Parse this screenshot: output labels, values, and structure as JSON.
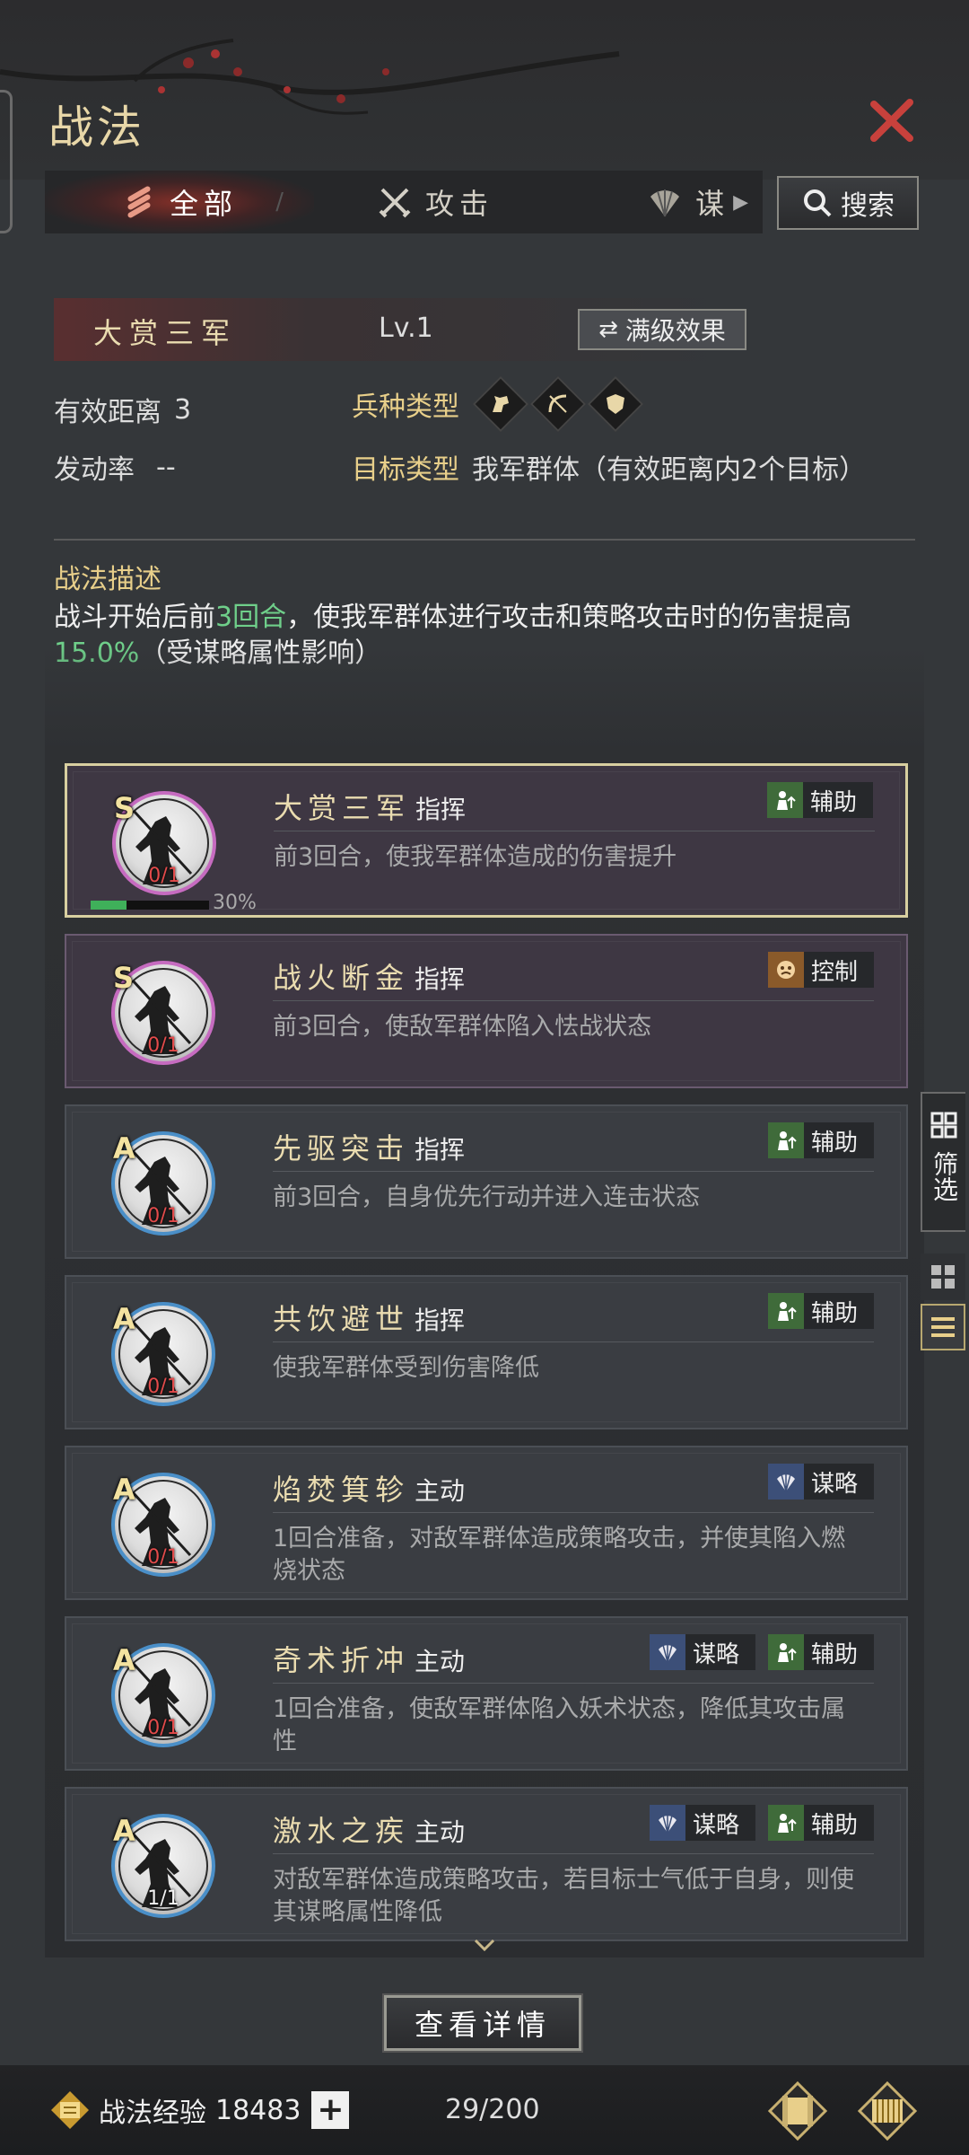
{
  "header": {
    "title": "战法",
    "close_icon": "close-icon",
    "accent": "#c8413c"
  },
  "tabs": [
    {
      "label": "全部",
      "icon": "scroll-bundle-icon",
      "active": true
    },
    {
      "label": "攻击",
      "icon": "crossed-swords-icon",
      "active": false
    },
    {
      "label": "谋",
      "icon": "fan-icon",
      "active": false
    }
  ],
  "search": {
    "label": "搜索",
    "icon": "search-icon"
  },
  "skill": {
    "name": "大赏三军",
    "level": "Lv.1",
    "max_effect_label": "满级效果",
    "range_label": "有效距离",
    "range_value": "3",
    "unit_type_label": "兵种类型",
    "unit_icons": [
      "cavalry-icon",
      "archer-icon",
      "shield-icon"
    ],
    "trigger_label": "发动率",
    "trigger_value": "--",
    "target_label": "目标类型",
    "target_value": "我军群体（有效距离内2个目标）",
    "desc_title": "战法描述",
    "desc_part1": "战斗开始后前",
    "desc_hl1": "3回合",
    "desc_part2": "，使我军群体进行攻击和策略攻击时的伤害提高",
    "desc_hl2": "15.0%",
    "desc_part3": "（受谋略属性影响）"
  },
  "cards": [
    {
      "grade": "S",
      "name": "大赏三军",
      "type": "指挥",
      "desc": "前3回合，使我军群体造成的伤害提升",
      "count": "0/1",
      "tags": [
        {
          "label": "辅助",
          "icon": "support-icon",
          "color": "green"
        }
      ],
      "progress": 0.3,
      "progress_label": "30%"
    },
    {
      "grade": "S",
      "name": "战火断金",
      "type": "指挥",
      "desc": "前3回合，使敌军群体陷入怯战状态",
      "count": "0/1",
      "tags": [
        {
          "label": "控制",
          "icon": "control-icon",
          "color": "orange"
        }
      ]
    },
    {
      "grade": "A",
      "name": "先驱突击",
      "type": "指挥",
      "desc": "前3回合，自身优先行动并进入连击状态",
      "count": "0/1",
      "tags": [
        {
          "label": "辅助",
          "icon": "support-icon",
          "color": "green"
        }
      ]
    },
    {
      "grade": "A",
      "name": "共饮避世",
      "type": "指挥",
      "desc": "使我军群体受到伤害降低",
      "count": "0/1",
      "tags": [
        {
          "label": "辅助",
          "icon": "support-icon",
          "color": "green"
        }
      ]
    },
    {
      "grade": "A",
      "name": "焰焚箕轸",
      "type": "主动",
      "desc": "1回合准备，对敌军群体造成策略攻击，并使其陷入燃烧状态",
      "count": "0/1",
      "tags": [
        {
          "label": "谋略",
          "icon": "strategy-icon",
          "color": "blue"
        }
      ]
    },
    {
      "grade": "A",
      "name": "奇术折冲",
      "type": "主动",
      "desc": "1回合准备，使敌军群体陷入妖术状态，降低其攻击属性",
      "count": "0/1",
      "tags": [
        {
          "label": "谋略",
          "icon": "strategy-icon",
          "color": "blue"
        },
        {
          "label": "辅助",
          "icon": "support-icon",
          "color": "green"
        }
      ]
    },
    {
      "grade": "A",
      "name": "激水之疾",
      "type": "主动",
      "desc": "对敌军群体造成策略攻击，若目标士气低于自身，则使其谋略属性降低",
      "count": "1/1",
      "tags": [
        {
          "label": "谋略",
          "icon": "strategy-icon",
          "color": "blue"
        },
        {
          "label": "辅助",
          "icon": "support-icon",
          "color": "green"
        }
      ]
    }
  ],
  "side": {
    "filter_label": "筛选"
  },
  "detail_button": "查看详情",
  "bottom": {
    "exp_label": "战法经验",
    "exp_value": "18483",
    "plus": "+",
    "capacity": "29/200"
  }
}
